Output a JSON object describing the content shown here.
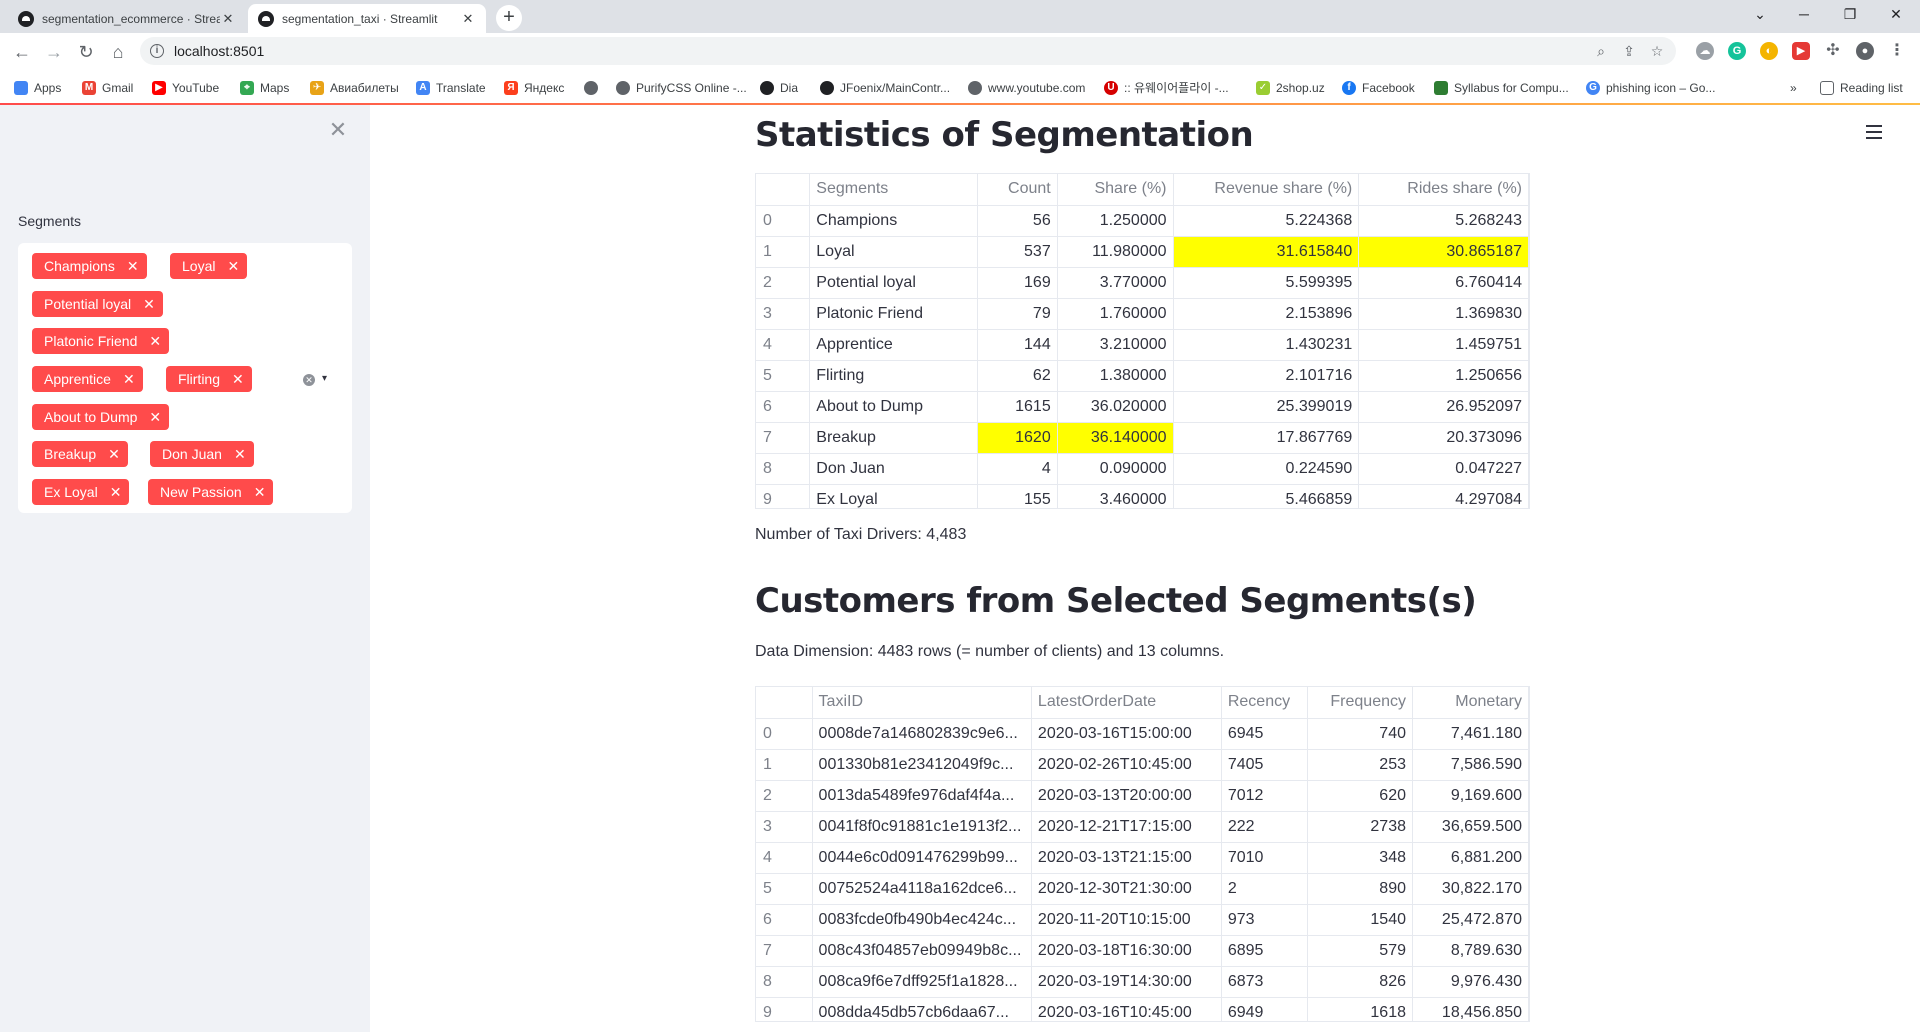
{
  "browser": {
    "tabs": [
      {
        "title": "segmentation_ecommerce · Streamlit",
        "close": "✕"
      },
      {
        "title": "segmentation_taxi · Streamlit",
        "close": "✕"
      }
    ],
    "new_tab": "+",
    "url": "localhost:8501",
    "window_controls": {
      "tabsearch": "⌄",
      "minimize": "─",
      "restore": "❐",
      "close": "✕"
    },
    "bookmarks": [
      {
        "label": "Apps",
        "color": "#4285f4"
      },
      {
        "label": "Gmail",
        "color": "#ea4335"
      },
      {
        "label": "YouTube",
        "color": "#ff0000"
      },
      {
        "label": "Maps",
        "color": "#34a853"
      },
      {
        "label": "Авиабилеты",
        "color": "#e8a317"
      },
      {
        "label": "Translate",
        "color": "#4285f4"
      },
      {
        "label": "Яндекс",
        "color": "#fc3f1d"
      },
      {
        "label": "",
        "color": "#5f6368"
      },
      {
        "label": "PurifyCSS Online -...",
        "color": "#5f6368"
      },
      {
        "label": "Dia",
        "color": "#202124"
      },
      {
        "label": "JFoenix/MainContr...",
        "color": "#202124"
      },
      {
        "label": "www.youtube.com",
        "color": "#5f6368"
      },
      {
        "label": ":: 유웨이어플라이 -...",
        "color": "#d50000"
      },
      {
        "label": "2shop.uz",
        "color": "#9acd32"
      },
      {
        "label": "Facebook",
        "color": "#1877f2"
      },
      {
        "label": "Syllabus for Compu...",
        "color": "#2e7d32"
      },
      {
        "label": "phishing icon – Go...",
        "color": "#4285f4"
      }
    ],
    "bookmarks_more": "»",
    "reading_list": "Reading list"
  },
  "sidebar": {
    "label": "Segments",
    "chips": [
      "Champions",
      "Loyal",
      "Potential loyal",
      "Platonic Friend",
      "Apprentice",
      "Flirting",
      "About to Dump",
      "Breakup",
      "Don Juan",
      "Ex Loyal",
      "New Passion"
    ],
    "chip_remove": "✕",
    "clear_glyph": "✕",
    "caret_glyph": "▾",
    "close_glyph": "✕"
  },
  "stats": {
    "title": "Statistics of Segmentation",
    "columns": [
      "",
      "Segments",
      "Count",
      "Share (%)",
      "Revenue share (%)",
      "Rides share (%)"
    ],
    "rows": [
      [
        "0",
        "Champions",
        "56",
        "1.250000",
        "5.224368",
        "5.268243"
      ],
      [
        "1",
        "Loyal",
        "537",
        "11.980000",
        "31.615840",
        "30.865187"
      ],
      [
        "2",
        "Potential loyal",
        "169",
        "3.770000",
        "5.599395",
        "6.760414"
      ],
      [
        "3",
        "Platonic Friend",
        "79",
        "1.760000",
        "2.153896",
        "1.369830"
      ],
      [
        "4",
        "Apprentice",
        "144",
        "3.210000",
        "1.430231",
        "1.459751"
      ],
      [
        "5",
        "Flirting",
        "62",
        "1.380000",
        "2.101716",
        "1.250656"
      ],
      [
        "6",
        "About to Dump",
        "1615",
        "36.020000",
        "25.399019",
        "26.952097"
      ],
      [
        "7",
        "Breakup",
        "1620",
        "36.140000",
        "17.867769",
        "20.373096"
      ],
      [
        "8",
        "Don Juan",
        "4",
        "0.090000",
        "0.224590",
        "0.047227"
      ],
      [
        "9",
        "Ex Loyal",
        "155",
        "3.460000",
        "5.466859",
        "4.297084"
      ]
    ],
    "highlight_color": "#ffff00",
    "driver_count_text": "Number of Taxi Drivers: 4,483"
  },
  "customers": {
    "title": "Customers from Selected Segments(s)",
    "dimension_text": "Data Dimension: 4483 rows (= number of clients) and 13 columns.",
    "columns": [
      "",
      "TaxiID",
      "LatestOrderDate",
      "Recency",
      "Frequency",
      "Monetary"
    ],
    "rows": [
      [
        "0",
        "0008de7a146802839c9e6...",
        "2020-03-16T15:00:00",
        "6945",
        "740",
        "7,461.180"
      ],
      [
        "1",
        "001330b81e23412049f9c...",
        "2020-02-26T10:45:00",
        "7405",
        "253",
        "7,586.590"
      ],
      [
        "2",
        "0013da5489fe976daf4f4a...",
        "2020-03-13T20:00:00",
        "7012",
        "620",
        "9,169.600"
      ],
      [
        "3",
        "0041f8f0c91881c1e1913f2...",
        "2020-12-21T17:15:00",
        "222",
        "2738",
        "36,659.500"
      ],
      [
        "4",
        "0044e6c0d091476299b99...",
        "2020-03-13T21:15:00",
        "7010",
        "348",
        "6,881.200"
      ],
      [
        "5",
        "00752524a4118a162dce6...",
        "2020-12-30T21:30:00",
        "2",
        "890",
        "30,822.170"
      ],
      [
        "6",
        "0083fcde0fb490b4ec424c...",
        "2020-11-20T10:15:00",
        "973",
        "1540",
        "25,472.870"
      ],
      [
        "7",
        "008c43f04857eb09949b8c...",
        "2020-03-18T16:30:00",
        "6895",
        "579",
        "8,789.630"
      ],
      [
        "8",
        "008ca9f6e7dff925f1a1828...",
        "2020-03-19T14:30:00",
        "6873",
        "826",
        "9,976.430"
      ],
      [
        "9",
        "008dda45db57cb6daa67...",
        "2020-03-16T10:45:00",
        "6949",
        "1618",
        "18,456.850"
      ]
    ]
  }
}
